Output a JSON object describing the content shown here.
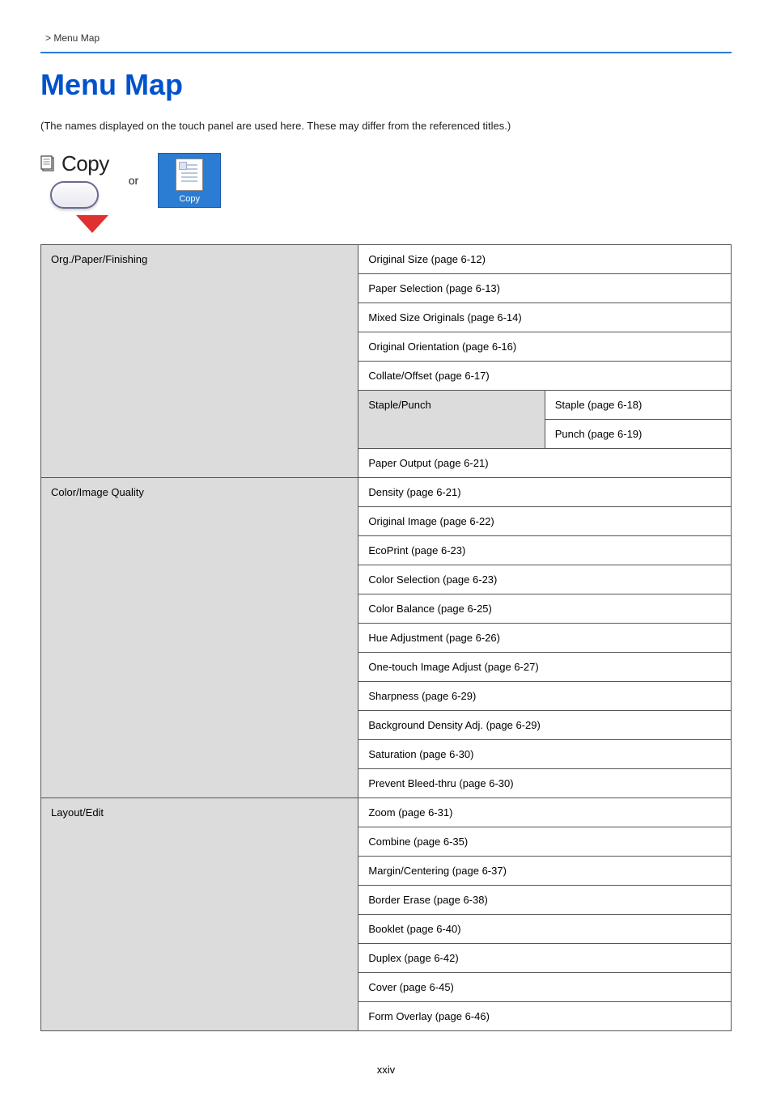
{
  "breadcrumb": " > Menu Map",
  "title": "Menu Map",
  "intro": "(The names displayed on the touch panel are used here. These may differ from the referenced titles.)",
  "copy_label": "Copy",
  "or_label": "or",
  "soft_button_label": "Copy",
  "page_number": "xxiv",
  "sections": {
    "s1": {
      "category": "Org./Paper/Finishing",
      "items": {
        "i1": "Original Size (page 6-12)",
        "i2": "Paper Selection (page 6-13)",
        "i3": "Mixed Size Originals (page 6-14)",
        "i4": "Original Orientation (page 6-16)",
        "i5": "Collate/Offset (page 6-17)",
        "i6_left": "Staple/Punch",
        "i6_r1": "Staple (page 6-18)",
        "i6_r2": "Punch (page 6-19)",
        "i7": "Paper Output (page 6-21)"
      }
    },
    "s2": {
      "category": "Color/Image Quality",
      "items": {
        "i1": "Density (page 6-21)",
        "i2": "Original Image (page 6-22)",
        "i3": "EcoPrint (page 6-23)",
        "i4": "Color Selection (page 6-23)",
        "i5": "Color Balance (page 6-25)",
        "i6": "Hue Adjustment (page 6-26)",
        "i7": "One-touch Image Adjust (page 6-27)",
        "i8": "Sharpness (page 6-29)",
        "i9": "Background Density Adj. (page 6-29)",
        "i10": "Saturation (page 6-30)",
        "i11": "Prevent Bleed-thru (page 6-30)"
      }
    },
    "s3": {
      "category": "Layout/Edit",
      "items": {
        "i1": "Zoom (page 6-31)",
        "i2": "Combine (page 6-35)",
        "i3": "Margin/Centering (page 6-37)",
        "i4": "Border Erase (page 6-38)",
        "i5": "Booklet (page 6-40)",
        "i6": "Duplex (page 6-42)",
        "i7": "Cover (page 6-45)",
        "i8": "Form Overlay (page 6-46)"
      }
    }
  }
}
